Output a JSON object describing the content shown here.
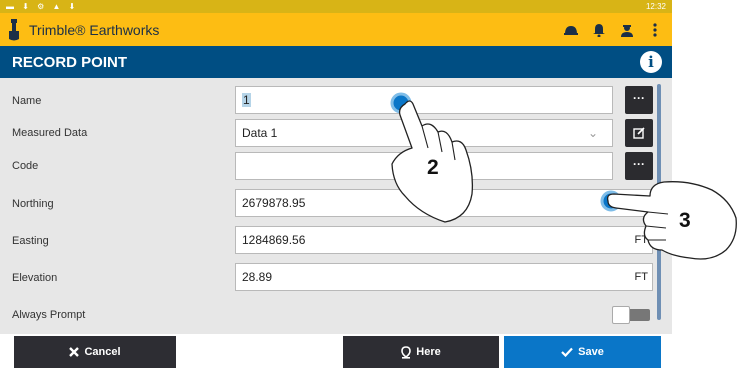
{
  "statusbar": {
    "time": "12:32"
  },
  "app": {
    "title": "Trimble® Earthworks"
  },
  "page": {
    "title": "RECORD POINT"
  },
  "form": {
    "name": {
      "label": "Name",
      "value": "1"
    },
    "measured_data": {
      "label": "Measured Data",
      "value": "Data 1"
    },
    "code": {
      "label": "Code",
      "value": ""
    },
    "northing": {
      "label": "Northing",
      "value": "2679878.95",
      "unit": "FT"
    },
    "easting": {
      "label": "Easting",
      "value": "1284869.56",
      "unit": "FT"
    },
    "elevation": {
      "label": "Elevation",
      "value": "28.89",
      "unit": "FT"
    },
    "always_prompt": {
      "label": "Always Prompt"
    }
  },
  "buttons": {
    "more": "···",
    "cancel": "Cancel",
    "here": "Here",
    "save": "Save"
  },
  "callouts": {
    "first": "2",
    "second": "3"
  },
  "colors": {
    "accent": "#fdbd13",
    "title_bar": "#004e83",
    "save": "#0a76c8"
  }
}
